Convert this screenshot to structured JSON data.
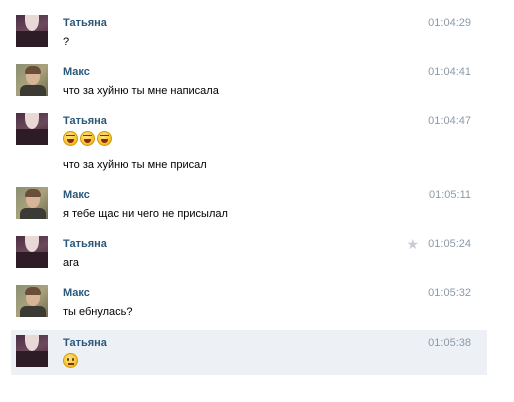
{
  "messages": [
    {
      "author": "Татьяна",
      "time": "01:04:29",
      "text": "?"
    },
    {
      "author": "Макс",
      "time": "01:04:41",
      "text": "что за хуйню ты мне написала"
    },
    {
      "author": "Татьяна",
      "time": "01:04:47",
      "emojis": [
        "laughing-emoji",
        "laughing-emoji",
        "laughing-emoji"
      ],
      "text": "что за хуйню ты мне присал"
    },
    {
      "author": "Макс",
      "time": "01:05:11",
      "text": "я тебе щас ни чего не присылал"
    },
    {
      "author": "Татьяна",
      "time": "01:05:24",
      "text": "ага",
      "starred": true
    },
    {
      "author": "Макс",
      "time": "01:05:32",
      "text": "ты ебнулась?"
    },
    {
      "author": "Татьяна",
      "time": "01:05:38",
      "emojis": [
        "neutral-face-emoji"
      ],
      "highlighted": true
    }
  ],
  "icons": {
    "star": "star-icon"
  },
  "colors": {
    "author_name": "#2b587a",
    "timestamp": "#8b9aa9",
    "highlight_bg": "#edf1f5"
  }
}
